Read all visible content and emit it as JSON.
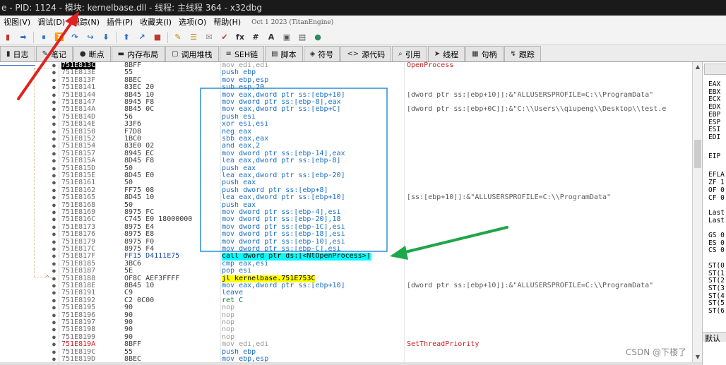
{
  "window": {
    "title": "e - PID: 1124 - 模块: kernelbase.dll - 线程: 主线程 364 - x32dbg"
  },
  "menu": {
    "items": [
      "视图(V)",
      "调试(D)",
      "跟踪(N)",
      "插件(P)",
      "收藏夹(I)",
      "选项(O)",
      "帮助(H)"
    ],
    "version": "Oct 1 2023 (TitanEngine)"
  },
  "toolbar": {
    "glyphs": [
      "▮",
      "➡",
      "⏸",
      "⏬",
      "↷",
      "↪",
      "⬇",
      "⬆",
      "↗",
      "■",
      "✎",
      "☰",
      "✉",
      "✔",
      "fx",
      "#",
      "A",
      "▣",
      "▤",
      "●"
    ]
  },
  "tabs": [
    {
      "icon": "▮",
      "label": "日志"
    },
    {
      "icon": "✎",
      "label": "笔记"
    },
    {
      "icon": "●",
      "label": "断点"
    },
    {
      "icon": "▬",
      "label": "内存布局"
    },
    {
      "icon": "▢",
      "label": "调用堆栈"
    },
    {
      "icon": "≡",
      "label": "SEH链"
    },
    {
      "icon": "▤",
      "label": "脚本"
    },
    {
      "icon": "◈",
      "label": "符号"
    },
    {
      "icon": "<>",
      "label": "源代码"
    },
    {
      "icon": "⌕",
      "label": "引用"
    },
    {
      "icon": "➤",
      "label": "线程"
    },
    {
      "icon": "▦",
      "label": "句柄"
    },
    {
      "icon": "↯",
      "label": "跟踪"
    }
  ],
  "disasm": [
    {
      "addr": "751E813C",
      "bytes": "8BFF",
      "instr": "mov edi,edi",
      "comment": "OpenProcess",
      "cur": true,
      "ic": "nop",
      "cc": "red"
    },
    {
      "addr": "751E813E",
      "bytes": "55",
      "instr": "push ebp"
    },
    {
      "addr": "751E813F",
      "bytes": "8BEC",
      "instr": "mov ebp,esp"
    },
    {
      "addr": "751E8141",
      "bytes": "83EC 20",
      "instr": "sub esp,20"
    },
    {
      "addr": "751E8144",
      "bytes": "8B45 10",
      "instr": "mov eax,dword ptr ss:[ebp+10]",
      "comment": "[dword ptr ss:[ebp+10]]:&\"ALLUSERSPROFILE=C:\\\\ProgramData\""
    },
    {
      "addr": "751E8147",
      "bytes": "8945 F8",
      "instr": "mov dword ptr ss:[ebp-8],eax"
    },
    {
      "addr": "751E814A",
      "bytes": "8B45 0C",
      "instr": "mov eax,dword ptr ss:[ebp+C]",
      "comment": "[dword ptr ss:[ebp+0C]]:&\"C:\\\\Users\\\\qiupeng\\\\Desktop\\\\test.e"
    },
    {
      "addr": "751E814D",
      "bytes": "56",
      "instr": "push esi"
    },
    {
      "addr": "751E814E",
      "bytes": "33F6",
      "instr": "xor esi,esi"
    },
    {
      "addr": "751E8150",
      "bytes": "F7D8",
      "instr": "neg eax"
    },
    {
      "addr": "751E8152",
      "bytes": "1BC0",
      "instr": "sbb eax,eax"
    },
    {
      "addr": "751E8154",
      "bytes": "83E0 02",
      "instr": "and eax,2"
    },
    {
      "addr": "751E8157",
      "bytes": "8945 EC",
      "instr": "mov dword ptr ss:[ebp-14],eax"
    },
    {
      "addr": "751E815A",
      "bytes": "8D45 F8",
      "instr": "lea eax,dword ptr ss:[ebp-8]"
    },
    {
      "addr": "751E815D",
      "bytes": "50",
      "instr": "push eax"
    },
    {
      "addr": "751E815E",
      "bytes": "8D45 E0",
      "instr": "lea eax,dword ptr ss:[ebp-20]"
    },
    {
      "addr": "751E8161",
      "bytes": "50",
      "instr": "push eax"
    },
    {
      "addr": "751E8162",
      "bytes": "FF75 08",
      "instr": "push dword ptr ss:[ebp+8]"
    },
    {
      "addr": "751E8165",
      "bytes": "8D45 10",
      "instr": "lea eax,dword ptr ss:[ebp+10]",
      "comment": "[ss:[ebp+10]]:&\"ALLUSERSPROFILE=C:\\\\ProgramData\""
    },
    {
      "addr": "751E8168",
      "bytes": "50",
      "instr": "push eax"
    },
    {
      "addr": "751E8169",
      "bytes": "8975 FC",
      "instr": "mov dword ptr ss:[ebp-4],esi"
    },
    {
      "addr": "751E816C",
      "bytes": "C745 E0 18000000",
      "instr": "mov dword ptr ss:[ebp-20],18"
    },
    {
      "addr": "751E8173",
      "bytes": "8975 E4",
      "instr": "mov dword ptr ss:[ebp-1C],esi"
    },
    {
      "addr": "751E8176",
      "bytes": "8975 E8",
      "instr": "mov dword ptr ss:[ebp-18],esi"
    },
    {
      "addr": "751E8179",
      "bytes": "8975 F0",
      "instr": "mov dword ptr ss:[ebp-10],esi"
    },
    {
      "addr": "751E817C",
      "bytes": "8975 F4",
      "instr": "mov dword ptr ss:[ebp-C],esi"
    },
    {
      "addr": "751E817F",
      "bytes": "FF15 D4111E75",
      "instr": "call dword ptr ds:[<NtOpenProcess>]",
      "ic": "callhl",
      "bc": "blue"
    },
    {
      "addr": "751E8185",
      "bytes": "3BC6",
      "instr": "cmp eax,esi"
    },
    {
      "addr": "751E8187",
      "bytes": "5E",
      "instr": "pop esi"
    },
    {
      "addr": "751E8188",
      "bytes": "OF8C AEF3FFFF",
      "instr": "jl kernelbase.751E753C",
      "ic": "jmphl",
      "jump": "^"
    },
    {
      "addr": "751E818E",
      "bytes": "8B45 10",
      "instr": "mov eax,dword ptr ss:[ebp+10]",
      "comment": "[dword ptr ss:[ebp+10]]:&\"ALLUSERSPROFILE=C:\\\\ProgramData\""
    },
    {
      "addr": "751E8191",
      "bytes": "C9",
      "instr": "leave"
    },
    {
      "addr": "751E8192",
      "bytes": "C2 0C00",
      "instr": "ret C",
      "ic": "green"
    },
    {
      "addr": "751E8195",
      "bytes": "90",
      "instr": "nop",
      "ic": "nop"
    },
    {
      "addr": "751E8196",
      "bytes": "90",
      "instr": "nop",
      "ic": "nop"
    },
    {
      "addr": "751E8197",
      "bytes": "90",
      "instr": "nop",
      "ic": "nop"
    },
    {
      "addr": "751E8198",
      "bytes": "90",
      "instr": "nop",
      "ic": "nop"
    },
    {
      "addr": "751E8199",
      "bytes": "90",
      "instr": "nop",
      "ic": "nop"
    },
    {
      "addr": "751E819A",
      "bytes": "8BFF",
      "instr": "mov edi,edi",
      "comment": "SetThreadPriority",
      "ac": "red",
      "ic": "nop",
      "cc": "red"
    },
    {
      "addr": "751E819C",
      "bytes": "55",
      "instr": "push ebp"
    },
    {
      "addr": "751E819D",
      "bytes": "8BEC",
      "instr": "mov ebp,esp"
    }
  ],
  "registers": [
    {
      "label": "EAX",
      "row": 0
    },
    {
      "label": "EBX",
      "row": 1
    },
    {
      "label": "ECX",
      "row": 2
    },
    {
      "label": "EDX",
      "row": 3
    },
    {
      "label": "EBP",
      "row": 4
    },
    {
      "label": "ESP",
      "row": 5
    },
    {
      "label": "ESI",
      "row": 6
    },
    {
      "label": "EDI",
      "row": 7
    },
    {
      "label": "EIP",
      "row": 9.5
    },
    {
      "label": "EFLA",
      "row": 12
    },
    {
      "label": "ZF 1",
      "row": 13
    },
    {
      "label": "OF 0",
      "row": 14
    },
    {
      "label": "CF 0",
      "row": 15
    },
    {
      "label": "Last",
      "row": 17
    },
    {
      "label": "Last",
      "row": 18
    },
    {
      "label": "GS 0",
      "row": 20
    },
    {
      "label": "ES 0",
      "row": 21
    },
    {
      "label": "CS 0",
      "row": 22
    },
    {
      "label": "ST(0",
      "row": 24
    },
    {
      "label": "ST(1",
      "row": 25
    },
    {
      "label": "ST(2",
      "row": 26
    },
    {
      "label": "ST(3",
      "row": 27
    },
    {
      "label": "ST(4",
      "row": 28
    },
    {
      "label": "ST(5",
      "row": 29
    },
    {
      "label": "ST(6",
      "row": 30
    }
  ],
  "register_panel": {
    "default_label": "默认"
  },
  "watermark": "CSDN @下楼了"
}
